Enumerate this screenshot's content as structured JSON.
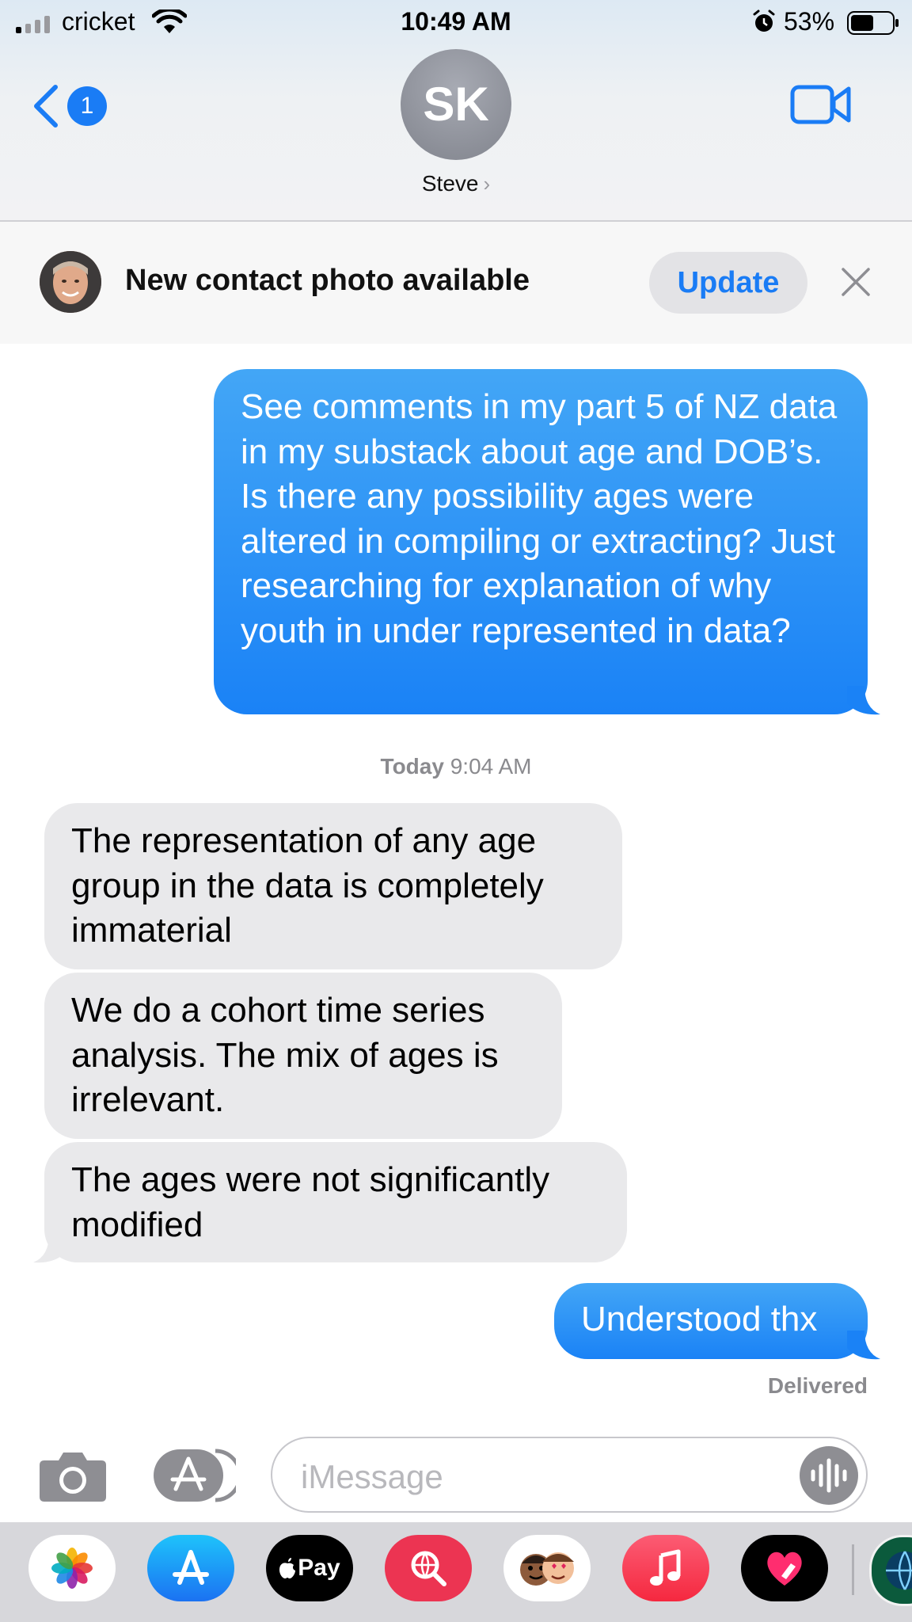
{
  "status_bar": {
    "carrier": "cricket",
    "time": "10:49 AM",
    "battery_percent": "53%",
    "icons": [
      "signal-icon",
      "wifi-icon",
      "alarm-icon",
      "battery-icon"
    ]
  },
  "header": {
    "back_badge_count": "1",
    "contact_initials": "SK",
    "contact_name": "Steve",
    "contact_chevron": "›",
    "icons": [
      "back-chevron-icon",
      "video-camera-icon"
    ]
  },
  "banner": {
    "text": "New contact photo available",
    "update_label": "Update",
    "icons": [
      "contact-photo",
      "close-icon"
    ]
  },
  "conversation": {
    "sent_1": "See comments in my part 5 of NZ data in my substack about age and DOB’s.  Is there any possibility ages were altered in compiling or extracting?  Just researching for explanation of why youth in under represented in data?",
    "timestamp_day": "Today",
    "timestamp_time": "9:04 AM",
    "received": [
      "The representation of any age group in the data is completely immaterial",
      "We do a cohort time series analysis. The mix of ages is irrelevant.",
      "The ages were not significantly modified"
    ],
    "sent_2": "Understood thx",
    "delivered_label": "Delivered"
  },
  "input_bar": {
    "placeholder": "iMessage",
    "icons": [
      "camera-icon",
      "app-store-icon",
      "audio-waveform-icon"
    ]
  },
  "app_drawer": {
    "apps": [
      "photos-icon",
      "app-store-icon",
      "apple-pay-icon",
      "image-search-icon",
      "memoji-icon",
      "music-icon",
      "digital-touch-icon",
      "more-apps-icon"
    ],
    "apple_pay_label": "Pay"
  },
  "colors": {
    "sent_bubble": "#1a82f6",
    "received_bubble": "#e9e9eb",
    "accent_blue": "#1a7cf5",
    "banner_bg": "#f7f7f7"
  }
}
